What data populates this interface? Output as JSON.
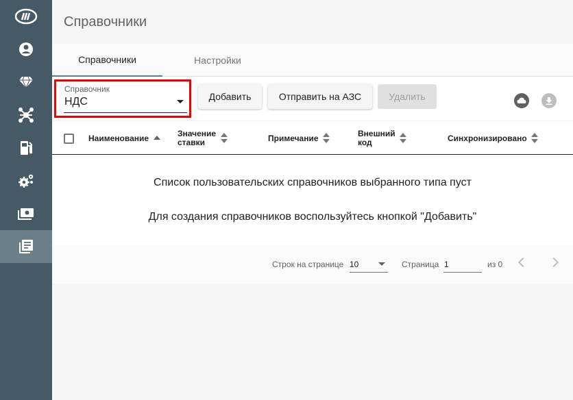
{
  "page": {
    "title": "Справочники"
  },
  "sidebar": {
    "items": [
      {
        "icon": "brand-logo-icon"
      },
      {
        "icon": "account-icon"
      },
      {
        "icon": "diamond-icon"
      },
      {
        "icon": "network-icon"
      },
      {
        "icon": "fuel-station-icon"
      },
      {
        "icon": "settings-gears-icon"
      },
      {
        "icon": "cash-icon"
      },
      {
        "icon": "reference-books-icon",
        "active": true
      }
    ]
  },
  "tabs": [
    {
      "label": "Справочники",
      "active": true
    },
    {
      "label": "Настройки",
      "active": false
    }
  ],
  "toolbar": {
    "select_label": "Справочник",
    "select_value": "НДС",
    "add_label": "Добавить",
    "send_label": "Отправить на АЗС",
    "delete_label": "Удалить",
    "cloud_icon": "cloud-icon",
    "download_icon": "download-icon"
  },
  "table": {
    "columns": [
      {
        "label": "Наименование",
        "sort": "asc"
      },
      {
        "label_1": "Значение",
        "label_2": "ставки",
        "sort": "none"
      },
      {
        "label": "Примечание",
        "sort": "none"
      },
      {
        "label_1": "Внешний",
        "label_2": "код",
        "sort": "none"
      },
      {
        "label": "Синхронизировано",
        "sort": "none"
      }
    ],
    "empty_message_1": "Список пользовательских справочников выбранного типа пуст",
    "empty_message_2": "Для создания справочников воспользуйтесь кнопкой \"Добавить\""
  },
  "pagination": {
    "rows_label": "Строк на странице",
    "rows_value": "10",
    "page_label": "Страница",
    "page_value": "1",
    "of_label": "из 0"
  },
  "colors": {
    "sidebar": "#455a64",
    "sidebar_active": "#6b7f89",
    "highlight": "#ee0000"
  }
}
